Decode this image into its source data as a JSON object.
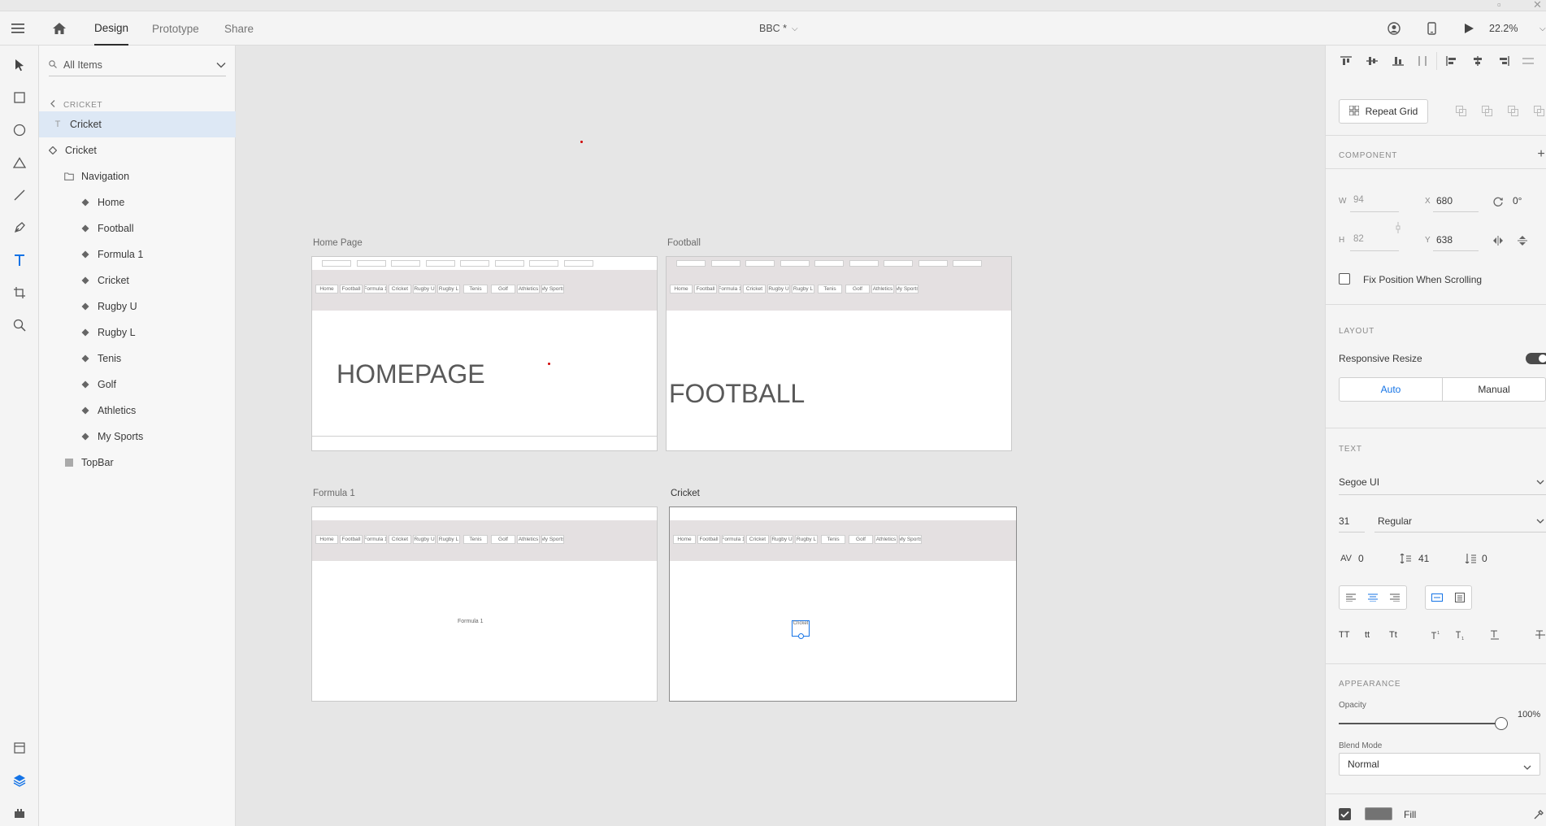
{
  "topbar": {
    "tabs": [
      "Design",
      "Prototype",
      "Share"
    ],
    "doc_title": "BBC *",
    "zoom": "22.2%"
  },
  "layers": {
    "search_placeholder": "All Items",
    "back_label": "CRICKET",
    "items": [
      {
        "label": "Cricket",
        "icon": "text-icon",
        "selected": true
      },
      {
        "label": "Cricket",
        "icon": "component-icon"
      },
      {
        "label": "Navigation",
        "icon": "folder-icon"
      },
      {
        "label": "Home",
        "icon": "component-icon"
      },
      {
        "label": "Football",
        "icon": "component-icon"
      },
      {
        "label": "Formula 1",
        "icon": "component-icon"
      },
      {
        "label": "Cricket",
        "icon": "component-icon"
      },
      {
        "label": "Rugby U",
        "icon": "component-icon"
      },
      {
        "label": "Rugby L",
        "icon": "component-icon"
      },
      {
        "label": "Tenis",
        "icon": "component-icon"
      },
      {
        "label": "Golf",
        "icon": "component-icon"
      },
      {
        "label": "Athletics",
        "icon": "component-icon"
      },
      {
        "label": "My Sports",
        "icon": "component-icon"
      },
      {
        "label": "TopBar",
        "icon": "rectangle-icon"
      }
    ]
  },
  "canvas": {
    "artboards": [
      {
        "title": "Home Page",
        "label": "HOMEPAGE"
      },
      {
        "title": "Football",
        "label": "FOOTBALL"
      },
      {
        "title": "Formula 1",
        "label": "Formula 1"
      },
      {
        "title": "Cricket",
        "label": "Cricket"
      }
    ],
    "nav_items": [
      "Home",
      "Football",
      "Formula 1",
      "Cricket",
      "Rugby U",
      "Rugby L",
      "Tenis",
      "Golf",
      "Athletics",
      "My Sports"
    ]
  },
  "props": {
    "repeat_grid": "Repeat Grid",
    "component_title": "COMPONENT",
    "w_label": "W",
    "w": "94",
    "h_label": "H",
    "h": "82",
    "x_label": "X",
    "x": "680",
    "y_label": "Y",
    "y": "638",
    "rotation": "0°",
    "fix_position": "Fix Position When Scrolling",
    "layout_title": "LAYOUT",
    "responsive_resize": "Responsive Resize",
    "auto": "Auto",
    "manual": "Manual",
    "text_title": "TEXT",
    "font": "Segoe UI",
    "font_size": "31",
    "font_weight": "Regular",
    "char_spacing": "0",
    "line_spacing": "41",
    "para_spacing": "0",
    "text_transforms": [
      "TT",
      "tt",
      "Tt"
    ],
    "appearance_title": "APPEARANCE",
    "opacity_label": "Opacity",
    "opacity": "100%",
    "blend_label": "Blend Mode",
    "blend": "Normal",
    "fill_label": "Fill",
    "fill_color": "#737373",
    "accent_color": "#1473e6"
  }
}
